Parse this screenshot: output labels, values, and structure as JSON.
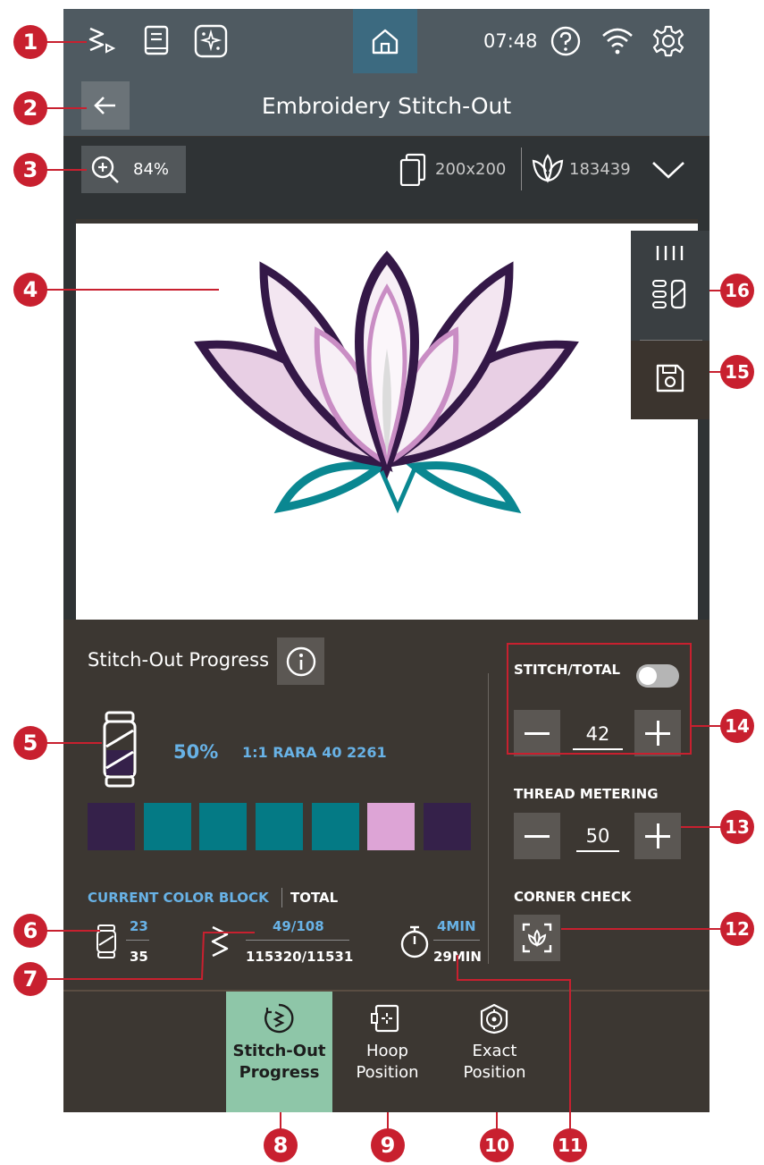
{
  "topbar": {
    "time": "07:48"
  },
  "titlebar": {
    "title": "Embroidery Stitch-Out"
  },
  "toolbar": {
    "zoom": "84%",
    "hoop": "200x200",
    "stitch_count": "183439"
  },
  "panel": {
    "heading": "Stitch-Out Progress",
    "percent": "50%",
    "thread": "1:1 RARA 40 2261",
    "swatches": [
      "#35214a",
      "#047a85",
      "#047a85",
      "#047a85",
      "#047a85",
      "#dda4d6",
      "#35214a"
    ],
    "legend_current": "CURRENT COLOR BLOCK",
    "legend_total": "TOTAL",
    "color_current": "23",
    "color_total": "35",
    "stitch_current": "49/108",
    "stitch_total": "115320/11531",
    "time_current": "4MIN",
    "time_total": "29MIN",
    "stitch_total_label": "STITCH/TOTAL",
    "stitch_step_value": "42",
    "thread_metering_label": "THREAD METERING",
    "thread_metering_value": "50",
    "corner_check_label": "CORNER CHECK"
  },
  "bottomnav": {
    "tabs": [
      {
        "line1": "Stitch-Out",
        "line2": "Progress",
        "active": true
      },
      {
        "line1": "Hoop",
        "line2": "Position",
        "active": false
      },
      {
        "line1": "Exact",
        "line2": "Position",
        "active": false
      }
    ]
  },
  "callouts": [
    "1",
    "2",
    "3",
    "4",
    "5",
    "6",
    "7",
    "8",
    "9",
    "10",
    "11",
    "12",
    "13",
    "14",
    "15",
    "16"
  ],
  "colors": {
    "accent_callout": "#c8202f",
    "active_tab": "#8ec6a8",
    "info_blue": "#68b2e6",
    "home_button": "#3c6a80"
  }
}
